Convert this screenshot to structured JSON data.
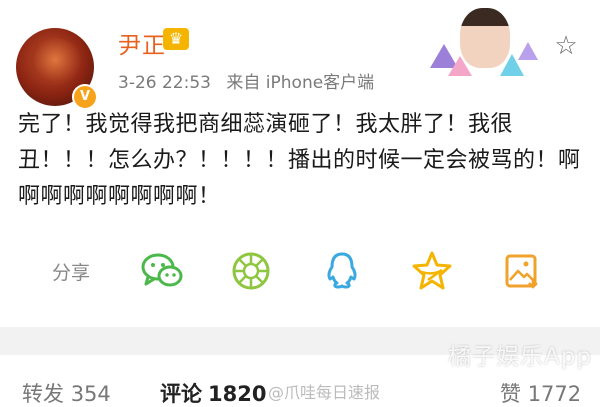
{
  "user": {
    "name": "尹正",
    "verified_badge": "V",
    "crown_badge": "♛"
  },
  "post": {
    "date": "3-26 22:53",
    "source": "来自 iPhone客户端",
    "text": "完了！我觉得我把商细蕊演砸了！我太胖了！我很丑！！！怎么办？！！！！播出的时候一定会被骂的！啊啊啊啊啊啊啊啊啊！"
  },
  "actions": {
    "share_label": "分享",
    "icons": [
      "wechat-icon",
      "moments-icon",
      "qq-icon",
      "qzone-icon",
      "save-image-icon"
    ],
    "colors": {
      "wechat": "#4bb84a",
      "moments": "#8fc63f",
      "qq": "#3aa9e0",
      "qzone": "#f5b400",
      "save": "#f0a22b"
    }
  },
  "stats": {
    "repost_label": "转发",
    "repost_count": "354",
    "comment_label": "评论",
    "comment_count": "1820",
    "like_label": "赞",
    "like_count": "1772"
  },
  "watermarks": {
    "main": "橘子娱乐App",
    "secondary": "@爪哇每日速报"
  }
}
